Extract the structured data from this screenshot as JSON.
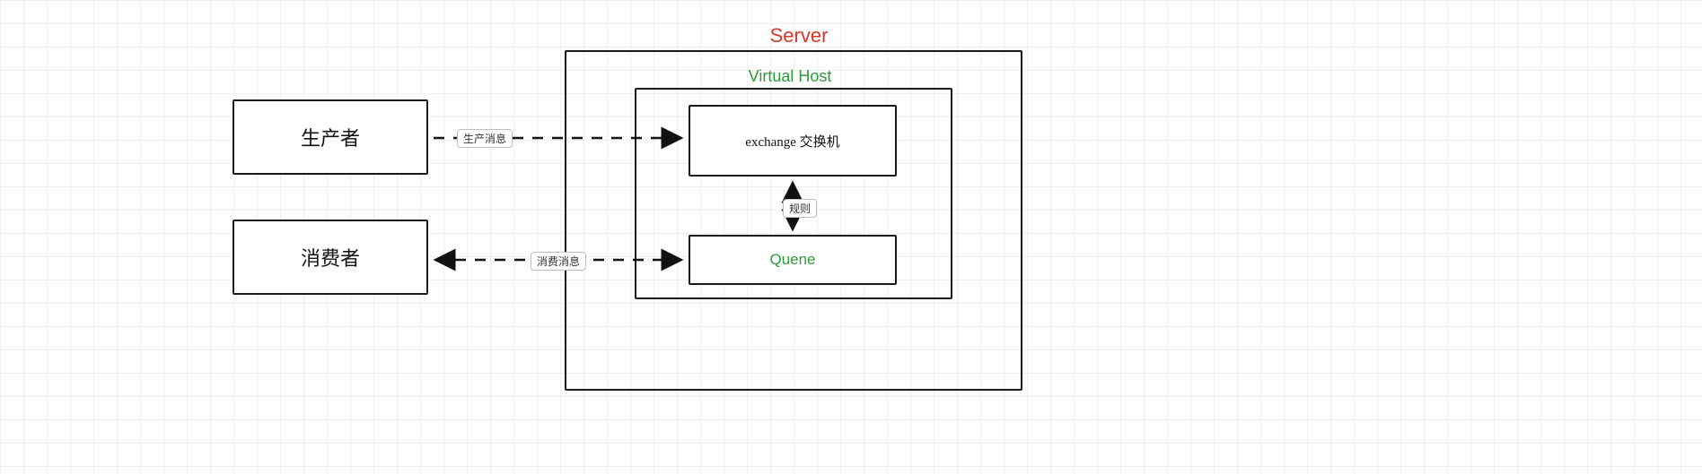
{
  "server_title": "Server",
  "vhost_title": "Virtual Host",
  "producer_label": "生产者",
  "consumer_label": "消费者",
  "exchange_label": "exchange 交换机",
  "queue_label": "Quene",
  "edge_produce_label": "生产消息",
  "edge_consume_label": "消费消息",
  "edge_rule_label": "规则",
  "colors": {
    "server_title": "#d33a2b",
    "vhost_title": "#2e9a3a",
    "queue_title": "#2e9a3a",
    "box_border": "#1a1a1a"
  },
  "chart_data": {
    "type": "diagram",
    "nodes": [
      {
        "id": "producer",
        "label": "生产者",
        "kind": "actor"
      },
      {
        "id": "consumer",
        "label": "消费者",
        "kind": "actor"
      },
      {
        "id": "server",
        "label": "Server",
        "kind": "container"
      },
      {
        "id": "vhost",
        "label": "Virtual Host",
        "kind": "container",
        "parent": "server"
      },
      {
        "id": "exchange",
        "label": "exchange 交换机",
        "kind": "component",
        "parent": "vhost"
      },
      {
        "id": "queue",
        "label": "Quene",
        "kind": "component",
        "parent": "vhost"
      }
    ],
    "edges": [
      {
        "from": "producer",
        "to": "exchange",
        "label": "生产消息",
        "style": "dashed",
        "direction": "forward"
      },
      {
        "from": "consumer",
        "to": "queue",
        "label": "消费消息",
        "style": "dashed",
        "direction": "both"
      },
      {
        "from": "exchange",
        "to": "queue",
        "label": "规则",
        "style": "dotted",
        "direction": "both"
      }
    ]
  }
}
